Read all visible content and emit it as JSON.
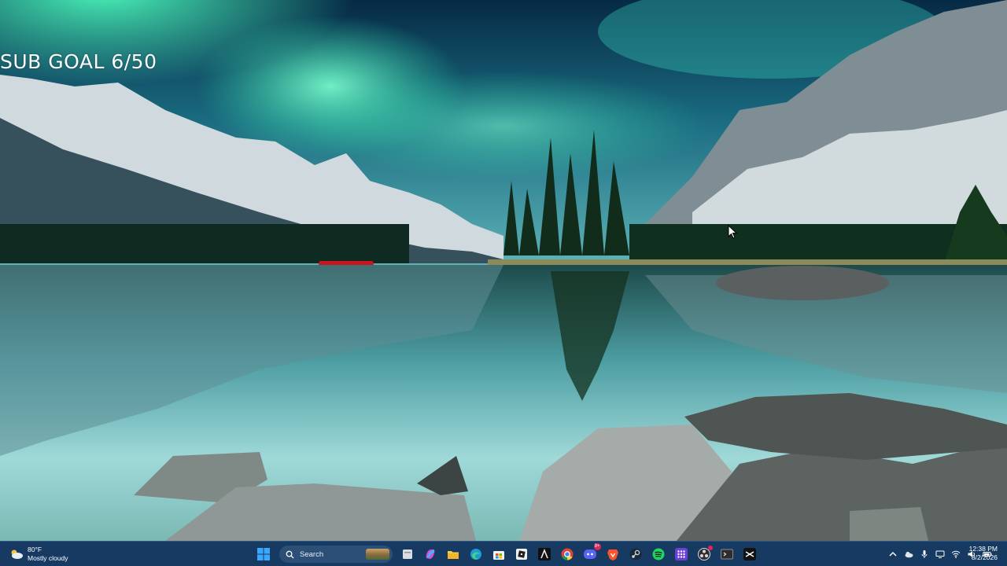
{
  "overlay": {
    "text": "SUB GOAL 6/50"
  },
  "taskbar": {
    "weather": {
      "temperature": "80°F",
      "condition": "Mostly cloudy",
      "icon": "cloud-sun-icon"
    },
    "search": {
      "placeholder": "Search",
      "icon": "search-icon"
    },
    "pinned": [
      "windows-start-icon",
      "file-manager-icon",
      "copilot-icon",
      "file-explorer-icon",
      "edge-browser-icon",
      "microsoft-store-icon",
      "roblox-icon",
      "app-a-icon",
      "chrome-icon",
      "discord-icon",
      "brave-icon",
      "steam-icon",
      "spotify-icon",
      "app-grid-icon",
      "obs-icon",
      "terminal-icon",
      "capcut-icon"
    ],
    "discord_badge": "9+",
    "tray": [
      "chevron-up-icon",
      "onedrive-icon",
      "microphone-icon",
      "display-icon",
      "wifi-icon",
      "volume-icon",
      "battery-icon"
    ],
    "clock": {
      "time": "12:38 PM",
      "date": "8/2/2026"
    }
  },
  "colors": {
    "taskbar": "#173a63",
    "aurora": "#3df2b0",
    "water": "#86d4d6"
  }
}
